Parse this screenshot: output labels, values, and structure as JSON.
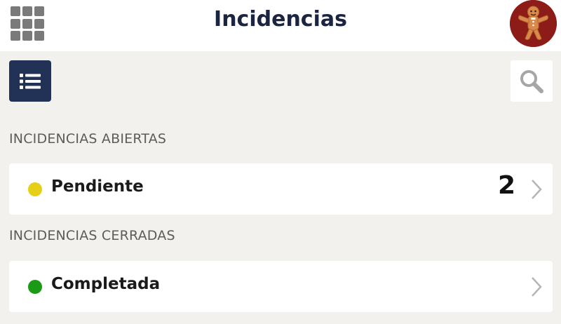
{
  "header": {
    "title": "Incidencias",
    "apps_icon": "grid-icon",
    "avatar_icon": "gingerbread-avatar"
  },
  "toolbar": {
    "list_icon": "list-icon",
    "search_icon": "search-icon"
  },
  "sections": [
    {
      "heading": "INCIDENCIAS ABIERTAS",
      "items": [
        {
          "label": "Pendiente",
          "count": "2",
          "status_color": "#e6d017"
        }
      ]
    },
    {
      "heading": "INCIDENCIAS CERRADAS",
      "items": [
        {
          "label": "Completada",
          "count": "",
          "status_color": "#1b9a16"
        }
      ]
    }
  ],
  "colors": {
    "background": "#f2f1ed",
    "navy": "#223156",
    "title": "#1b2440"
  }
}
